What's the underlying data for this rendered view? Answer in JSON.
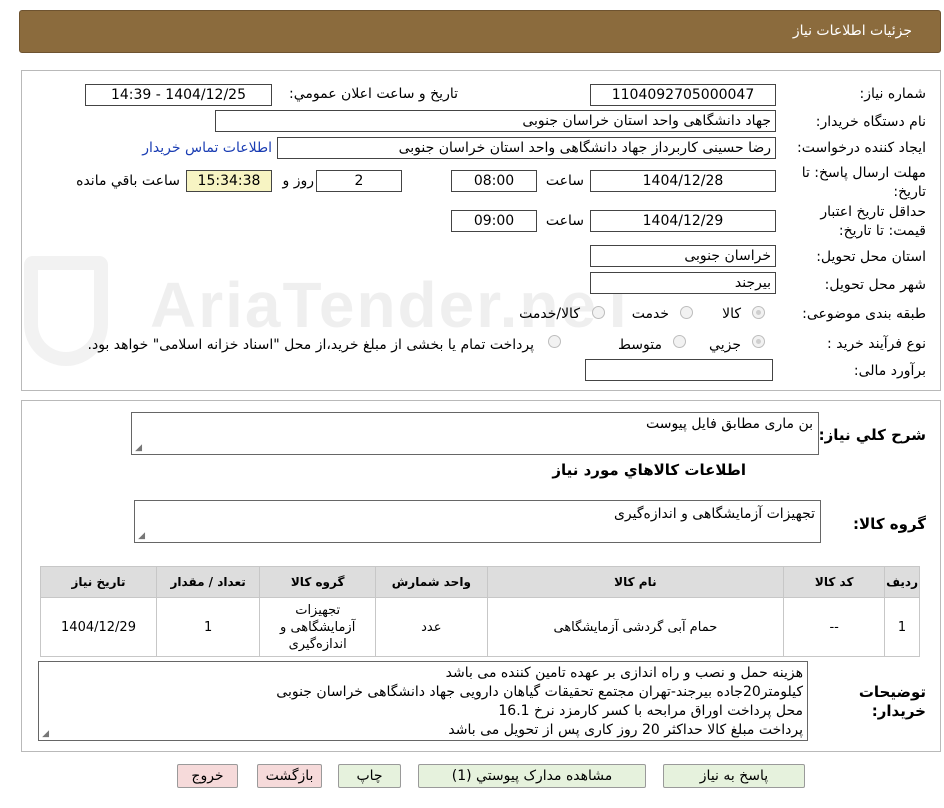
{
  "header": {
    "title": "جزئیات اطلاعات نیاز"
  },
  "watermark": "AriaTender.neT",
  "form": {
    "need_number_label": "شماره نیاز:",
    "need_number": "1104092705000047",
    "announce_label": "تاریخ و ساعت اعلان عمومي:",
    "announce_value": "1404/12/25 - 14:39",
    "buyer_org_label": "نام دستگاه خریدار:",
    "buyer_org": "جهاد دانشگاهی واحد استان خراسان جنوبی",
    "creator_label": "ایجاد کننده درخواست:",
    "creator": "رضا حسینی کاربرداز جهاد دانشگاهی واحد استان خراسان جنوبی",
    "contact_link": "اطلاعات تماس خریدار",
    "reply_deadline_label": "مهلت ارسال پاسخ: تا تاریخ:",
    "reply_date": "1404/12/28",
    "time_label": "ساعت",
    "reply_time": "08:00",
    "days_value": "2",
    "days_label": "روز و",
    "remaining_time": "15:34:38",
    "remaining_label": "ساعت باقي مانده",
    "validity_label": "حداقل تاریخ اعتبار قیمت: تا تاریخ:",
    "validity_date": "1404/12/29",
    "validity_time": "09:00",
    "province_label": "استان محل تحویل:",
    "province": "خراسان جنوبی",
    "city_label": "شهر محل تحویل:",
    "city": "بیرجند",
    "category_label": "طبقه بندی موضوعی:",
    "category_options": [
      "کالا",
      "خدمت",
      "کالا/خدمت"
    ],
    "process_label": "نوع فرآیند خرید :",
    "process_options": [
      "جزیي",
      "متوسط"
    ],
    "process_note": "پرداخت تمام یا بخشی از مبلغ خرید،از محل \"اسناد خزانه اسلامی\" خواهد بود.",
    "estimate_label": "برآورد مالی:",
    "estimate_value": ""
  },
  "description": {
    "label": "شرح کلي نیاز:",
    "value": "بن ماری مطابق فایل پیوست"
  },
  "goods": {
    "section_title": "اطلاعات کالاهاي مورد نیاز",
    "group_label": "گروه کالا:",
    "group_value": "تجهیزات آزمایشگاهی و اندازه‌گیری",
    "columns": [
      "ردیف",
      "کد کالا",
      "نام کالا",
      "واحد شمارش",
      "گروه کالا",
      "تعداد / مقدار",
      "تاریخ نیاز"
    ],
    "rows": [
      {
        "row": "1",
        "code": "--",
        "name": "حمام آبی گردشی آزمایشگاهی",
        "unit": "عدد",
        "group": "تجهیزات آزمایشگاهی و اندازه‌گیری",
        "qty": "1",
        "date": "1404/12/29"
      }
    ]
  },
  "buyer_notes": {
    "label": "توضیحات خریدار:",
    "lines": [
      "هزینه حمل و نصب و راه اندازی بر عهده تامین کننده می باشد",
      "کیلومتر20جاده بیرجند-تهران مجتمع تحقیقات گیاهان دارویی جهاد دانشگاهی خراسان جنوبی",
      "محل پرداخت اوراق مرابحه با کسر کارمزد نرخ 16.1",
      "پرداخت مبلغ کالا حداکثر 20 روز کاری پس از تحویل می باشد"
    ]
  },
  "buttons": {
    "reply": "پاسخ به نیاز",
    "attachments": "مشاهده مدارک پیوستي (1)",
    "print": "چاپ",
    "back": "بازگشت",
    "exit": "خروج"
  }
}
